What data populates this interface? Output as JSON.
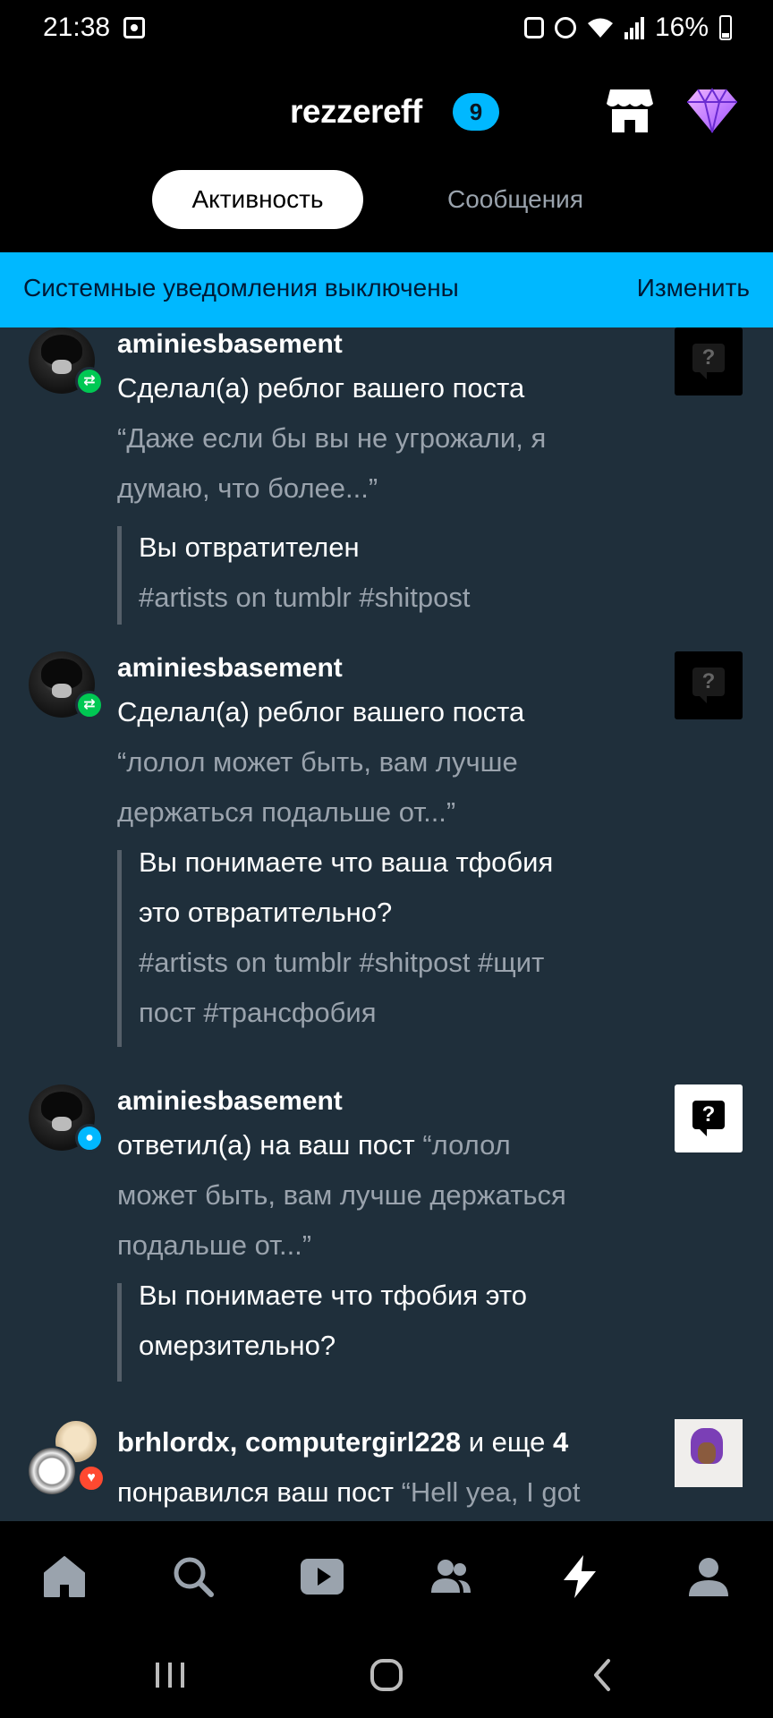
{
  "status_bar": {
    "time": "21:38",
    "battery": "16%"
  },
  "header": {
    "blog_name": "rezzereff",
    "badge_count": "9",
    "tab_activity": "Активность",
    "tab_messages": "Сообщения"
  },
  "banner": {
    "text": "Системные уведомления выключены",
    "link": "Изменить"
  },
  "notifications": [
    {
      "user": "aminiesbasement",
      "action": "Сделал(а) реблог вашего поста",
      "excerpt_line1": "“Даже если бы вы не угрожали, я",
      "excerpt_line2": "думаю, что более...”",
      "quote_lines": [
        "Вы отвратителен"
      ],
      "tags_lines": [
        "#artists on tumblr #shitpost"
      ]
    },
    {
      "user": "aminiesbasement",
      "action": "Сделал(а) реблог вашего поста",
      "excerpt_line1": "“лолол может быть, вам лучше",
      "excerpt_line2": "держаться подальше от...”",
      "quote_lines": [
        "Вы понимаете что ваша тфобия",
        "это отвратительно?"
      ],
      "tags_lines": [
        "#artists on tumblr #shitpost #щит",
        "пост #трансфобия"
      ]
    },
    {
      "user": "aminiesbasement",
      "action_prefix": "ответил(а) на ваш пост",
      "action_excerpt": " “лолол",
      "excerpt_line1": "может быть, вам лучше держаться",
      "excerpt_line2": "подальше от...”",
      "quote_lines": [
        "Вы понимаете что тфобия это",
        "омерзительно?"
      ]
    },
    {
      "users": "brhlordx, computergirl228",
      "and_more": " и еще ",
      "more_count": "4",
      "action_prefix": "понравился ваш пост",
      "action_excerpt": " “Hell yea, I got"
    }
  ],
  "icons": {
    "shop": "shop-icon",
    "gem": "gem-icon",
    "reblog": "reblog-icon",
    "reply": "reply-icon",
    "like": "heart-icon",
    "help": "question-bubble-icon"
  },
  "colors": {
    "accent": "#00b8ff",
    "feed_bg": "#1f2f3b",
    "reblog_green": "#00c853",
    "like_red": "#ff4930"
  }
}
